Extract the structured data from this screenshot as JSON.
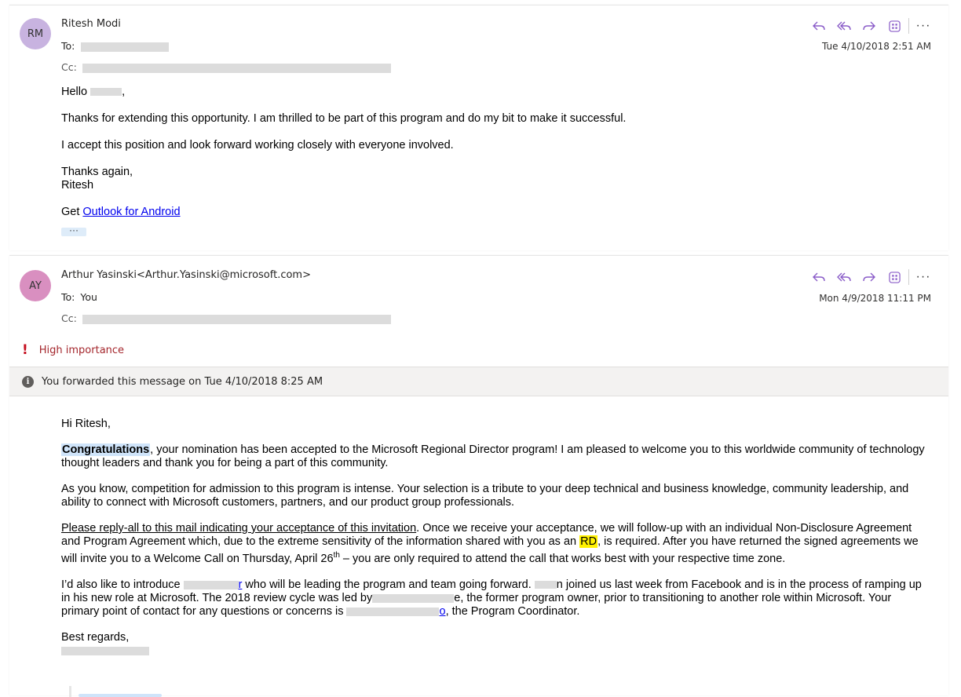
{
  "colors": {
    "avatar_rm": "#c8b3e0",
    "avatar_ay": "#d98fc0",
    "action_icon": "#8a5cc8",
    "importance": "#a4262c"
  },
  "message1": {
    "avatar_initials": "RM",
    "sender": "Ritesh Modi",
    "to_label": "To:",
    "cc_label": "Cc:",
    "date": "Tue 4/10/2018 2:51 AM",
    "greeting_prefix": "Hello",
    "greeting_suffix": ",",
    "para1": "Thanks for extending this opportunity. I am thrilled to be part of this program and do my bit to make it successful.",
    "para2": "I accept this position and look forward working closely with everyone involved.",
    "signoff1": "Thanks again,",
    "signoff2": "Ritesh",
    "get_label": "Get",
    "outlook_link": "Outlook for Android",
    "expand_dots": "···"
  },
  "message2": {
    "avatar_initials": "AY",
    "sender": "Arthur Yasinski<Arthur.Yasinski@microsoft.com>",
    "to_label": "To:",
    "to_value": "You",
    "cc_label": "Cc:",
    "date": "Mon 4/9/2018 11:11 PM",
    "importance_label": "High importance",
    "forwarded_note": "You forwarded this message on Tue 4/10/2018 8:25 AM",
    "greeting": "Hi Ritesh,",
    "p1_highlight": "Congratulations",
    "p1_rest": ", your nomination has been accepted to the Microsoft Regional Director program!  I am pleased to welcome you to this worldwide community of technology thought leaders and thank you for being a part of this community.",
    "p2": "As you know, competition for admission to this program is intense.  Your selection is a tribute to your deep technical and business knowledge, community leadership, and ability to connect with Microsoft customers, partners, and our product group professionals.",
    "p3_underlined": "Please reply-all to this mail indicating your acceptance of this invitation",
    "p3_a": ".  Once we receive your acceptance, we will follow-up with an individual Non-Disclosure Agreement and Program Agreement which, due to the extreme sensitivity of the information shared with you as an ",
    "p3_rd": "RD",
    "p3_b": ", is required.  After you have returned the signed agreements we will invite you to a Welcome Call on Thursday, April 26",
    "p3_sup": "th",
    "p3_c": " – you are only required to attend the call that works best with your respective time zone.",
    "p4_a": "I’d also like to introduce ",
    "p4_link1_tail": "r",
    "p4_b": " who will be leading the program and team going forward.  ",
    "p4_c": "n joined us last week from Facebook and is in the process of ramping up in his new role at Microsoft.  The 2018 review cycle was led by",
    "p4_d": "e, the former program owner, prior to transitioning to another role within Microsoft.  Your primary point of contact for any questions or concerns is ",
    "p4_link2_tail": "o",
    "p4_e": ", the Program Coordinator.",
    "closing": "Best regards,"
  }
}
